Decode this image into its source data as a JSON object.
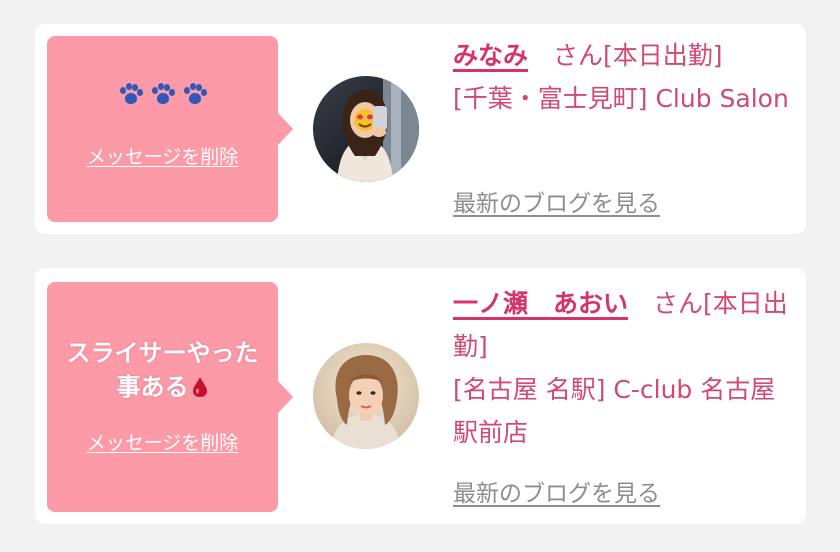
{
  "favorites": [
    {
      "message_icon": "paw-prints-icon",
      "message_text": "",
      "delete_label": "メッセージを削除",
      "name": "みなみ",
      "status": "　さん[本日出勤]",
      "shop": "[千葉・富士見町] Club Salon",
      "blog_label": "最新のブログを見る"
    },
    {
      "message_icon": "blood-drop-icon",
      "message_text_line1": "スライサーやった",
      "message_text_line2": "事ある",
      "delete_label": "メッセージを削除",
      "name": "一ノ瀬　あおい",
      "status": "　さん[本日出勤]",
      "shop": "[名古屋 名駅] C-club 名古屋駅前店",
      "blog_label": "最新のブログを見る"
    }
  ],
  "colors": {
    "background": "#f2f2f2",
    "bubble": "#fc9aa8",
    "name": "#d6336c",
    "text": "#d04a73",
    "blog_link": "#8e8e8e",
    "paw": "#2f58b8",
    "drop": "#c8102e"
  }
}
